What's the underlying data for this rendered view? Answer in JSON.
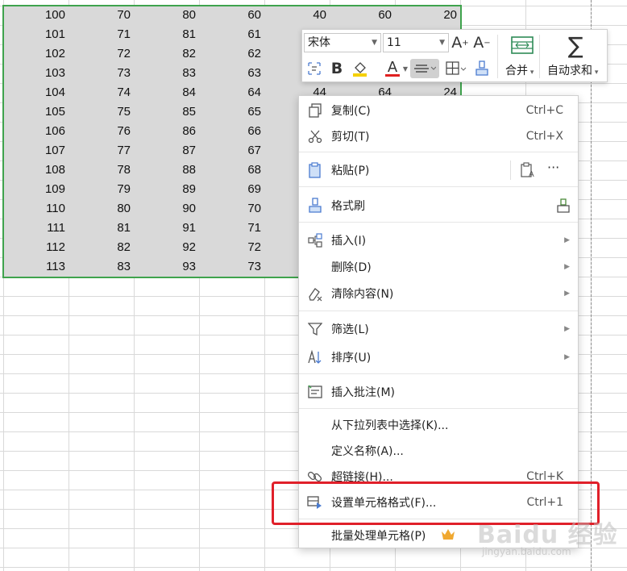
{
  "sheet": {
    "rows": [
      [
        "100",
        "70",
        "80",
        "60",
        "40",
        "60",
        "20"
      ],
      [
        "101",
        "71",
        "81",
        "61"
      ],
      [
        "102",
        "72",
        "82",
        "62"
      ],
      [
        "103",
        "73",
        "83",
        "63"
      ],
      [
        "104",
        "74",
        "84",
        "64",
        "44",
        "64",
        "24"
      ],
      [
        "105",
        "75",
        "85",
        "65"
      ],
      [
        "106",
        "76",
        "86",
        "66"
      ],
      [
        "107",
        "77",
        "87",
        "67"
      ],
      [
        "108",
        "78",
        "88",
        "68"
      ],
      [
        "109",
        "79",
        "89",
        "69"
      ],
      [
        "110",
        "80",
        "90",
        "70"
      ],
      [
        "111",
        "81",
        "91",
        "71"
      ],
      [
        "112",
        "82",
        "92",
        "72"
      ],
      [
        "113",
        "83",
        "93",
        "73"
      ]
    ],
    "selection_color": "#3fa34d"
  },
  "toolbar": {
    "font_name": "宋体",
    "font_size": "11",
    "merge_label": "合并",
    "autosum_label": "自动求和",
    "font_color": "#e02020",
    "highlight_color": "#f5d000"
  },
  "menu": {
    "copy": {
      "label": "复制(C)",
      "shortcut": "Ctrl+C"
    },
    "cut": {
      "label": "剪切(T)",
      "shortcut": "Ctrl+X"
    },
    "paste": {
      "label": "粘贴(P)",
      "more": "···"
    },
    "format_painter": {
      "label": "格式刷"
    },
    "insert": {
      "label": "插入(I)"
    },
    "delete": {
      "label": "删除(D)"
    },
    "clear": {
      "label": "清除内容(N)"
    },
    "filter": {
      "label": "筛选(L)"
    },
    "sort": {
      "label": "排序(U)"
    },
    "comment": {
      "label": "插入批注(M)"
    },
    "pick_list": {
      "label": "从下拉列表中选择(K)..."
    },
    "define_name": {
      "label": "定义名称(A)..."
    },
    "hyperlink": {
      "label": "超链接(H)...",
      "shortcut": "Ctrl+K"
    },
    "format_cells": {
      "label": "设置单元格格式(F)...",
      "shortcut": "Ctrl+1"
    },
    "batch": {
      "label": "批量处理单元格(P)"
    }
  },
  "highlight_color": "#e0202a",
  "watermark": {
    "main": "Baidu 经验",
    "sub": "jingyan.baidu.com"
  }
}
